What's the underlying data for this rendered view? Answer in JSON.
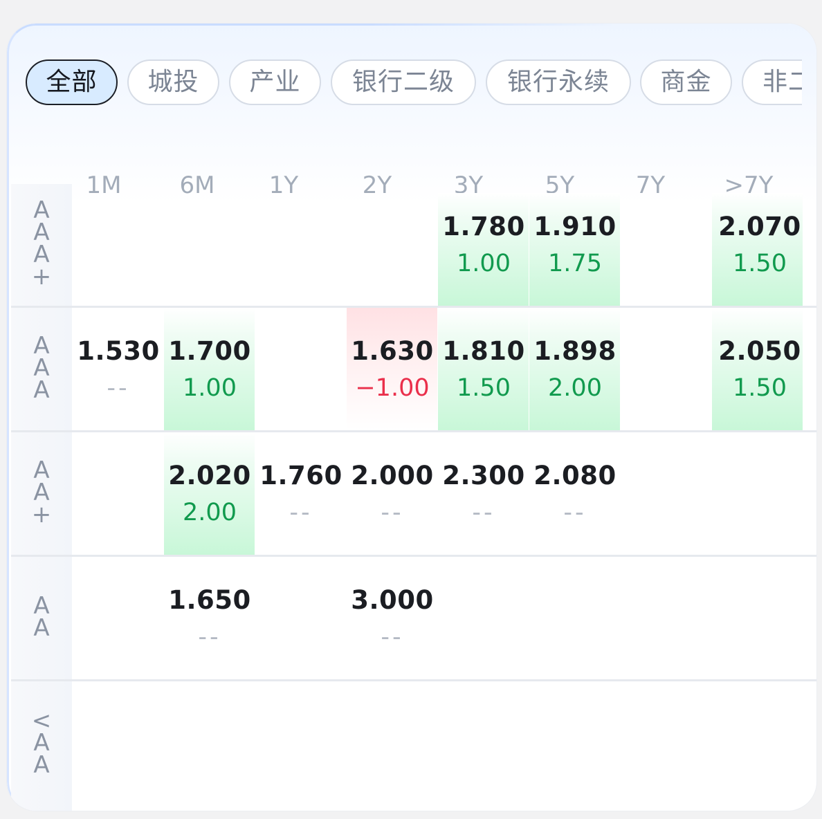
{
  "filters": {
    "chips": [
      "全部",
      "城投",
      "产业",
      "银行二级",
      "银行永续",
      "商金",
      "非二"
    ],
    "active": "全部"
  },
  "tenors": [
    "1M",
    "6M",
    "1Y",
    "2Y",
    "3Y",
    "5Y",
    "7Y",
    ">7Y"
  ],
  "ratings": [
    "AAA+",
    "AAA",
    "AA+",
    "AA",
    "<AA"
  ],
  "grid": {
    "row0": {
      "c4": {
        "yield": "1.780",
        "change": "1.00",
        "dir": "up"
      },
      "c5": {
        "yield": "1.910",
        "change": "1.75",
        "dir": "up"
      },
      "c7": {
        "yield": "2.070",
        "change": "1.50",
        "dir": "up"
      }
    },
    "row1": {
      "c0": {
        "yield": "1.530",
        "change": "--",
        "dir": "none"
      },
      "c1": {
        "yield": "1.700",
        "change": "1.00",
        "dir": "up"
      },
      "c3": {
        "yield": "1.630",
        "change": "−1.00",
        "dir": "down"
      },
      "c4": {
        "yield": "1.810",
        "change": "1.50",
        "dir": "up"
      },
      "c5": {
        "yield": "1.898",
        "change": "2.00",
        "dir": "up"
      },
      "c7": {
        "yield": "2.050",
        "change": "1.50",
        "dir": "up"
      }
    },
    "row2": {
      "c1": {
        "yield": "2.020",
        "change": "2.00",
        "dir": "up"
      },
      "c2": {
        "yield": "1.760",
        "change": "--",
        "dir": "none"
      },
      "c3": {
        "yield": "2.000",
        "change": "--",
        "dir": "none"
      },
      "c4": {
        "yield": "2.300",
        "change": "--",
        "dir": "none"
      },
      "c5": {
        "yield": "2.080",
        "change": "--",
        "dir": "none"
      }
    },
    "row3": {
      "c1": {
        "yield": "1.650",
        "change": "--",
        "dir": "none"
      },
      "c3": {
        "yield": "3.000",
        "change": "--",
        "dir": "none"
      }
    }
  },
  "colors": {
    "up": "#119a4e",
    "down": "#ea2f4b",
    "active_chip_bg": "#d8ebff",
    "highlight_green": "#c8f7d8",
    "highlight_red": "#ffe1e4"
  }
}
